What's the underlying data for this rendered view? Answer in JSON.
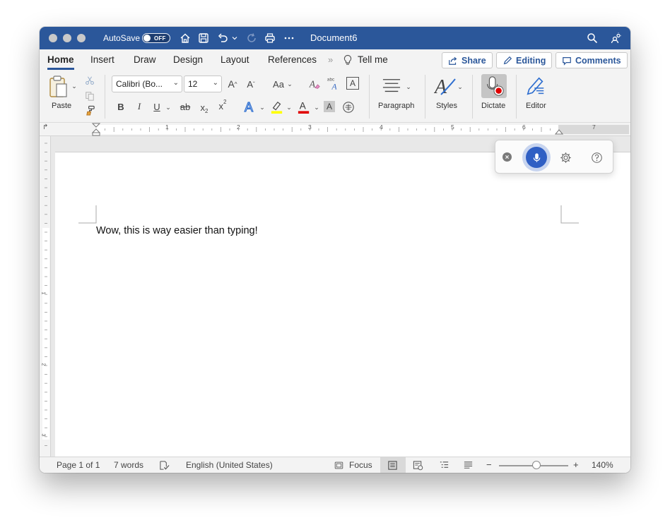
{
  "titlebar": {
    "autosave_label": "AutoSave",
    "autosave_state": "OFF",
    "document_title": "Document6",
    "icons": [
      "home-icon",
      "save-icon",
      "undo-icon",
      "redo-icon",
      "print-icon",
      "more-icon",
      "search-icon",
      "share-people-icon"
    ]
  },
  "tabs": {
    "items": [
      "Home",
      "Insert",
      "Draw",
      "Design",
      "Layout",
      "References"
    ],
    "overflow": "»",
    "tell_me": "Tell me",
    "share": "Share",
    "editing": "Editing",
    "comments": "Comments"
  },
  "ribbon": {
    "paste": "Paste",
    "font_name": "Calibri (Bo...",
    "font_size": "12",
    "change_case": "Aa",
    "bold": "B",
    "italic": "I",
    "underline": "U",
    "strike": "ab",
    "subscript": "x",
    "superscript": "x",
    "sub_mark": "2",
    "sup_mark": "2",
    "paragraph": "Paragraph",
    "styles": "Styles",
    "dictate": "Dictate",
    "editor": "Editor"
  },
  "ruler": {
    "numbers": [
      "1",
      "2",
      "3",
      "4",
      "5",
      "6",
      "7"
    ],
    "v_numbers": [
      "1",
      "2",
      "3"
    ]
  },
  "document": {
    "text": "Wow, this is way easier than typing!"
  },
  "dictation": {
    "icons": [
      "close-icon",
      "microphone-icon",
      "settings-icon",
      "help-icon"
    ]
  },
  "statusbar": {
    "page": "Page 1 of 1",
    "words": "7 words",
    "language": "English (United States)",
    "focus": "Focus",
    "zoom": "140%"
  },
  "colors": {
    "accent": "#2b579a",
    "mic": "#2f5fc4",
    "highlight": "#ffff00",
    "font_color": "#e00000"
  }
}
